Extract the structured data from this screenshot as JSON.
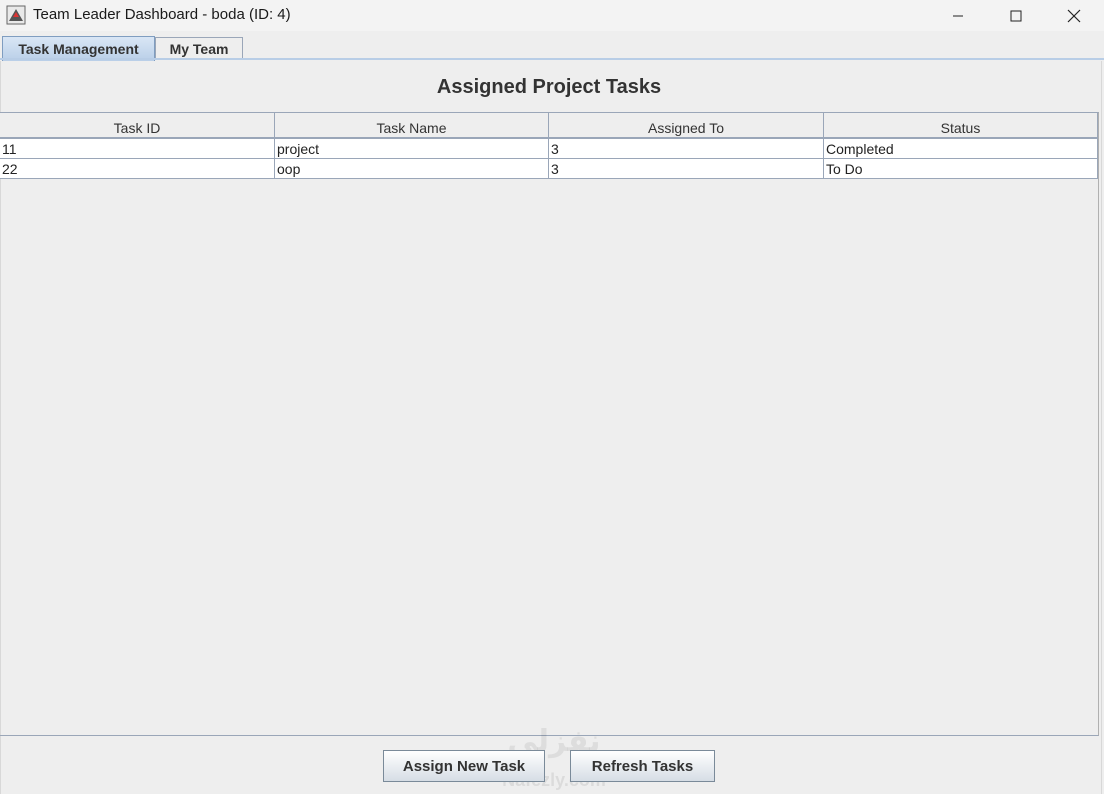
{
  "window": {
    "title": "Team Leader Dashboard - boda (ID: 4)"
  },
  "tabs": [
    {
      "label": "Task Management",
      "active": true
    },
    {
      "label": "My Team",
      "active": false
    }
  ],
  "main": {
    "heading": "Assigned Project Tasks",
    "columns": [
      "Task ID",
      "Task Name",
      "Assigned To",
      "Status"
    ],
    "rows": [
      [
        "11",
        "project",
        "3",
        "Completed"
      ],
      [
        "22",
        "oop",
        "3",
        "To Do"
      ]
    ]
  },
  "buttons": {
    "assign_label": "Assign New Task",
    "refresh_label": "Refresh Tasks"
  },
  "watermark": {
    "line1": "نفزلي",
    "line2": "Nafezly.com"
  },
  "colors": {
    "tab_active": "#c6d9ef",
    "header_border": "#9aa6b8",
    "background": "#eeeeee"
  }
}
